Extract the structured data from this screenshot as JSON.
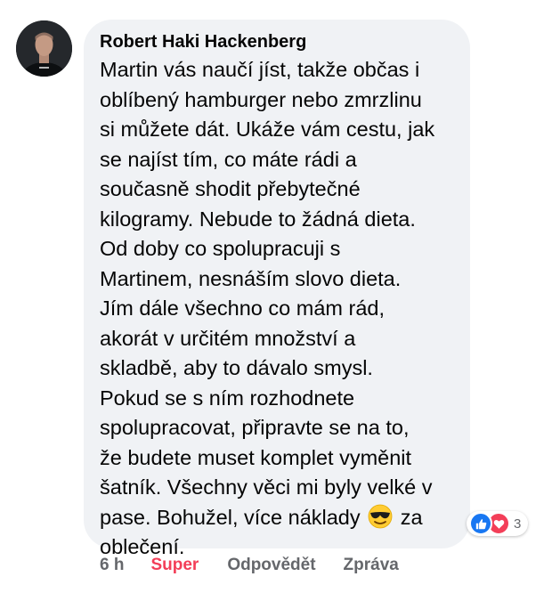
{
  "comment": {
    "author": "Robert Haki Hackenberg",
    "lines": [
      "Martin vás naučí jíst, takže občas i",
      "oblíbený hamburger nebo zmrzlinu",
      "si můžete dát. Ukáže vám cestu, jak",
      "se najíst tím, co máte rádi a",
      "současně shodit přebytečné",
      "kilogramy. Nebude to žádná dieta.",
      "Od doby co spolupracuji s",
      "Martinem, nesnáším slovo dieta.",
      "Jím dále všechno co mám rád,",
      "akorát v určitém množství a",
      "skladbě, aby to dávalo smysl.",
      "Pokud se s ním rozhodnete",
      "spolupracovat, připravte se na to,",
      "že budete muset komplet vyměnit",
      "šatník. Všechny věci mi byly velké v"
    ],
    "last_line_before_emoji": "pase. Bohužel, více náklady",
    "emoji": "smiling-face-with-sunglasses",
    "last_line_after_emoji": "za",
    "final_line": "oblečení."
  },
  "reactions": {
    "types": [
      "like-icon",
      "love-icon"
    ],
    "count": "3"
  },
  "actions": {
    "time": "6 h",
    "super": "Super",
    "reply": "Odpovědět",
    "message": "Zpráva"
  },
  "colors": {
    "bubble": "#f0f2f5",
    "text": "#050505",
    "muted": "#65676b",
    "super": "#f33e58",
    "like": "#1877f2",
    "love": "#f33e58"
  }
}
